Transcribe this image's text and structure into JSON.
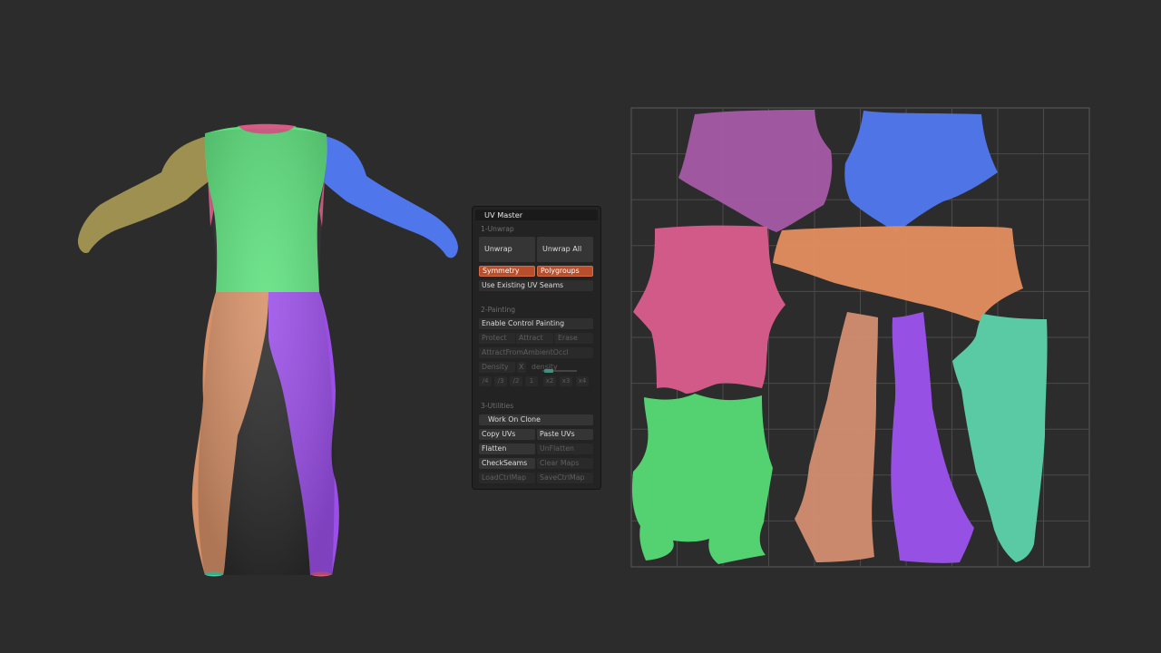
{
  "panel": {
    "title": "UV Master",
    "section_unwrap": "1-Unwrap",
    "unwrap": "Unwrap",
    "unwrap_all": "Unwrap All",
    "symmetry": "Symmetry",
    "polygroups": "Polygroups",
    "use_existing_seams": "Use Existing UV Seams",
    "section_painting": "2-Painting",
    "enable_control_painting": "Enable Control Painting",
    "protect": "Protect",
    "attract": "Attract",
    "erase": "Erase",
    "attract_ambient": "AttractFromAmbientOccl",
    "density": "Density",
    "density_x": "X",
    "density_label": "density",
    "density_steps": [
      "/4",
      "/3",
      "/2",
      "1",
      "x2",
      "x3",
      "x4"
    ],
    "section_utilities": "3-Utilities",
    "work_on_clone": "Work On Clone",
    "copy_uvs": "Copy UVs",
    "paste_uvs": "Paste UVs",
    "flatten": "Flatten",
    "unflatten": "UnFlatten",
    "check_seams": "CheckSeams",
    "clear_maps": "Clear Maps",
    "load_ctrl_map": "LoadCtrlMap",
    "save_ctrl_map": "SaveCtrlMap"
  },
  "colors": {
    "background": "#2c2c2c",
    "torso_green": "#5ee07e",
    "left_arm_olive": "#9e9050",
    "right_arm_blue": "#4f76ea",
    "left_leg_orange": "#d59068",
    "right_leg_purple": "#9b4fe8",
    "collar_pink": "#d65c86",
    "uv_mauve": "#a35aa3",
    "uv_blue": "#5077ec",
    "uv_pink": "#d85c8c",
    "uv_orange": "#df8c5e",
    "uv_green": "#56d874",
    "uv_tan": "#d08c6e",
    "uv_purple": "#9b52ea",
    "uv_teal": "#5cd0a8",
    "accent_toggle": "#b84f2c"
  }
}
